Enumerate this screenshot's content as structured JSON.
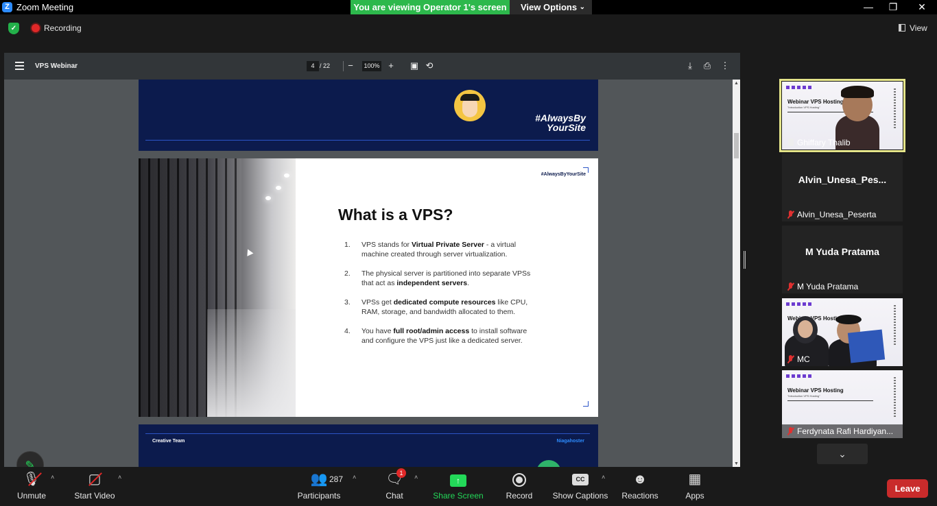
{
  "window": {
    "title": "Zoom Meeting",
    "banner": "You are viewing Operator 1's screen",
    "view_options": "View Options"
  },
  "status": {
    "recording": "Recording",
    "view": "View"
  },
  "pdf": {
    "title": "VPS Webinar",
    "current_page": "4",
    "total_pages": "/ 22",
    "zoom": "100%"
  },
  "slide3": {
    "hashtag_line1": "#AlwaysBy",
    "hashtag_line2": "YourSite"
  },
  "slide4": {
    "tag": "#AlwaysByYourSite",
    "heading": "What is a VPS?",
    "items": [
      {
        "num": "1.",
        "pre": "VPS stands for ",
        "bold": "Virtual Private Server",
        "post": " - a virtual machine created through server virtualization."
      },
      {
        "num": "2.",
        "pre": "The physical server is partitioned into separate VPSs that act as ",
        "bold": "independent servers",
        "post": "."
      },
      {
        "num": "3.",
        "pre": "VPSs get ",
        "bold": "dedicated compute resources",
        "post": " like CPU, RAM, storage, and bandwidth allocated to them."
      },
      {
        "num": "4.",
        "pre": "You have ",
        "bold": "full root/admin access",
        "post": " to install software and configure the VPS just like a dedicated server."
      }
    ]
  },
  "slide5": {
    "left": "Creative Team",
    "right": "Niagahoster"
  },
  "gallery": {
    "tiles": [
      {
        "name": "Ghiffary Thalib",
        "slide_title": "Webinar VPS Hosting",
        "slide_sub": "\"Introduction VPS Hosting\""
      },
      {
        "center": "Alvin_Unesa_Pes...",
        "name": "Alvin_Unesa_Peserta"
      },
      {
        "center": "M Yuda Pratama",
        "name": "M Yuda Pratama"
      },
      {
        "name": "MC",
        "slide_title": "Webinar VPS Hosting"
      },
      {
        "name": "Ferdynata Rafi Hardiyan...",
        "slide_title": "Webinar VPS Hosting",
        "slide_sub": "\"Introduction VPS Hosting\""
      }
    ]
  },
  "toolbar": {
    "unmute": "Unmute",
    "start_video": "Start Video",
    "participants_count": "287",
    "participants": "Participants",
    "chat_badge": "1",
    "chat": "Chat",
    "share_screen": "Share Screen",
    "record": "Record",
    "cc_icon": "CC",
    "show_captions": "Show Captions",
    "reactions": "Reactions",
    "apps": "Apps",
    "leave": "Leave"
  },
  "colors": {
    "accent_green": "#23d959",
    "navy": "#0c1b4d",
    "leave_red": "#c92b2b"
  }
}
